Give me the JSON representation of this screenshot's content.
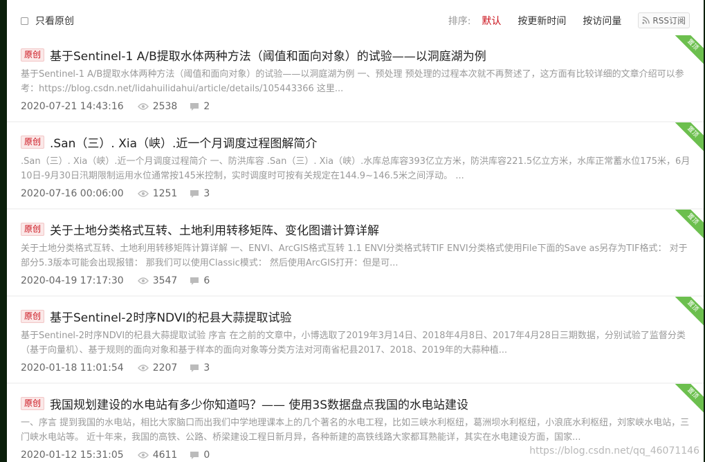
{
  "toolbar": {
    "only_original_label": "只看原创",
    "sort_label": "排序:",
    "sort_options": [
      "默认",
      "按更新时间",
      "按访问量"
    ],
    "rss_label": "RSS订阅"
  },
  "ribbon_label": "置顶",
  "badge_label": "原创",
  "articles": [
    {
      "title": "基于Sentinel-1 A/B提取水体两种方法（阈值和面向对象）的试验——以洞庭湖为例",
      "summary": "基于Sentinel-1 A/B提取水体两种方法（阈值和面向对象）的试验——以洞庭湖为例 一、预处理 预处理的过程本次就不再赘述了，这方面有比较详细的文章介绍可以参考：https://blog.csdn.net/lidahuilidahui/article/details/105443366 这里...",
      "date": "2020-07-21 14:43:16",
      "views": "2538",
      "comments": "2"
    },
    {
      "title": ".San（三）. Xia（峡）.近一个月调度过程图解简介",
      "summary": ".San（三）. Xia（峡）.近一个月调度过程简介 一、防洪库容 .San（三）. Xia（峡）.水库总库容393亿立方米，防洪库容221.5亿立方米，水库正常蓄水位175米，6月10日-9月30日汛期限制运用水位通常按145米控制，实时调度时可按有关规定在144.9~146.5米之间浮动。 ...",
      "date": "2020-07-16 00:06:00",
      "views": "1251",
      "comments": "3"
    },
    {
      "title": "关于土地分类格式互转、土地利用转移矩阵、变化图谱计算详解",
      "summary": "关于土地分类格式互转、土地利用转移矩阵计算详解 一、ENVI、ArcGIS格式互转 1.1 ENVI分类格式转TIF ENVI分类格式使用File下面的Save as另存为TIF格式： 对于部分5.3版本可能会出现报错： 那我们可以使用Classic模式： 然后使用ArcGIS打开：但是可...",
      "date": "2020-04-19 17:17:30",
      "views": "3547",
      "comments": "6"
    },
    {
      "title": "基于Sentinel-2时序NDVI的杞县大蒜提取试验",
      "summary": "基于Sentinel-2时序NDVI的杞县大蒜提取试验 序言 在之前的文章中，小博选取了2019年3月14日、2018年4月8日、2017年4月28日三期数据，分别试验了监督分类（基于向量机）、基于规则的面向对象和基于样本的面向对象等分类方法对河南省杞县2017、2018、2019年的大蒜种植...",
      "date": "2020-01-18 11:01:54",
      "views": "2207",
      "comments": "3"
    },
    {
      "title": "我国规划建设的水电站有多少你知道吗？—— 使用3S数据盘点我国的水电站建设",
      "summary": "一、序言 提到我国的水电站，相比大家脑口而出我们中学地理课本上的几个著名的水电工程，比如三峡水利枢纽，葛洲坝水利枢纽，小浪底水利枢纽，刘家峡水电站，三门峡水电站等。 近十年来，我国的高铁、公路、桥梁建设工程日新月异，各种新建的高铁线路大家都耳熟能详，其实在水电建设方面，国家...",
      "date": "2020-01-12 15:31:05",
      "views": "4611",
      "comments": "0"
    }
  ],
  "watermark": "https://blog.csdn.net/qq_46071146"
}
